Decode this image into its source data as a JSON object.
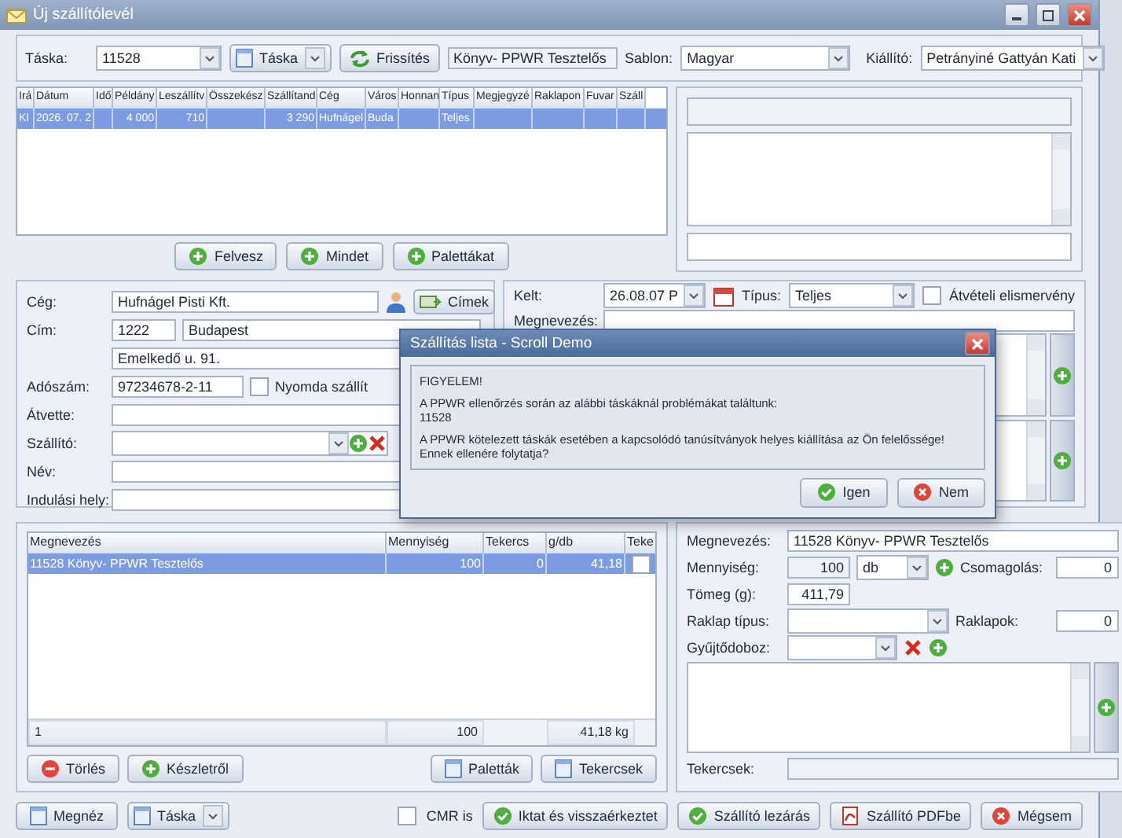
{
  "window": {
    "title": "Új szállítólevél"
  },
  "toolbar": {
    "task_label": "Táska:",
    "task_value": "11528",
    "task_button": "Táska",
    "refresh_button": "Frissítés",
    "product": "Könyv- PPWR Tesztelős",
    "template_label": "Sablon:",
    "template_value": "Magyar",
    "issuer_label": "Kiállító:",
    "issuer_value": "Petrányiné Gattyán Kati"
  },
  "jobs_table": {
    "columns": [
      "Irá",
      "Dátum",
      "Idő",
      "Példány",
      "Leszállítv",
      "Összekész",
      "Szállítand",
      "Cég",
      "Város",
      "Honnan",
      "Típus",
      "Megjegyzé",
      "Raklapon",
      "Fuvar",
      "Száll"
    ],
    "rows": [
      {
        "selected": true,
        "cells": [
          "KI",
          "2026. 07. 2",
          "",
          "4 000",
          "710",
          "",
          "3 290",
          "Hufnágel",
          "Buda",
          "",
          "Teljes",
          "",
          "",
          "",
          ""
        ]
      }
    ]
  },
  "task_buttons": [
    "Felvesz",
    "Mindet",
    "Palettákat"
  ],
  "customer": {
    "company_label": "Cég:",
    "company_value": "Hufnágel Pisti Kft.",
    "addresses_button": "Címek",
    "address_label": "Cím:",
    "zip": "1222",
    "city": "Budapest",
    "street": "Emelkedő u. 91.",
    "tax_label": "Adószám:",
    "tax_value": "97234678-2-11",
    "print_delivery": {
      "label": "Nyomda szállít",
      "checked": false
    },
    "receiver_label": "Átvette:",
    "carrier_label": "Szállító:",
    "name_label": "Név:",
    "departure_label": "Indulási hely:"
  },
  "delivery": {
    "date_label": "Kelt:",
    "date_value": "26.08.07 P",
    "type_label": "Típus:",
    "type_value": "Teljes",
    "receipt": {
      "label": "Átvételi elismervény",
      "checked": false
    },
    "name_label": "Megnevezés:"
  },
  "dialog": {
    "title": "Szállítás lista - Scroll Demo",
    "paragraphs": [
      "FIGYELEM!",
      "A PPWR ellenőrzés során az alábbi táskáknál problémákat találtunk:\n11528",
      "A PPWR kötelezett táskák esetében a kapcsolódó tanúsítványok helyes kiállítása az Ön felelőssége!\nEnnek ellenére folytatja?"
    ],
    "buttons": [
      {
        "label": "Igen",
        "kind": "yes"
      },
      {
        "label": "Nem",
        "kind": "no"
      }
    ]
  },
  "items_table": {
    "columns": [
      "Megnevezés",
      "Mennyiség",
      "Tekercs",
      "g/db",
      "Teke"
    ],
    "rows": [
      {
        "selected": true,
        "cells": [
          "11528 Könyv- PPWR Tesztelős",
          "100",
          "0",
          "41,18"
        ],
        "checked": false
      }
    ],
    "footer": [
      "1",
      "100",
      "41,18 kg"
    ]
  },
  "item_buttons": [
    {
      "label": "Törlés",
      "kind": "remove"
    },
    {
      "label": "Készletről",
      "kind": "add"
    },
    {
      "label": "Paletták",
      "kind": "sheet"
    },
    {
      "label": "Tekercsek",
      "kind": "sheet"
    }
  ],
  "item_detail": {
    "name_label": "Megnevezés:",
    "name_value": "11528 Könyv- PPWR Tesztelős",
    "qty_label": "Mennyiség:",
    "qty_value": "100",
    "unit": "db",
    "packing_label": "Csomagolás:",
    "packing_value": "0",
    "weight_label": "Tömeg (g):",
    "weight_value": "411,79",
    "pallet_type_label": "Raklap típus:",
    "pallets_label": "Raklapok:",
    "pallets_value": "0",
    "box_label": "Gyűjtődoboz:",
    "rolls_label": "Tekercsek:"
  },
  "footer": {
    "view_button": "Megnéz",
    "task_button": "Táska",
    "cmr": {
      "label": "CMR is",
      "checked": false
    },
    "actions": [
      {
        "label": "Iktat és visszaérkeztet",
        "kind": "ok"
      },
      {
        "label": "Szállító lezárás",
        "kind": "ok"
      },
      {
        "label": "Szállító PDFbe",
        "kind": "pdf"
      },
      {
        "label": "Mégsem",
        "kind": "cancel"
      }
    ]
  }
}
